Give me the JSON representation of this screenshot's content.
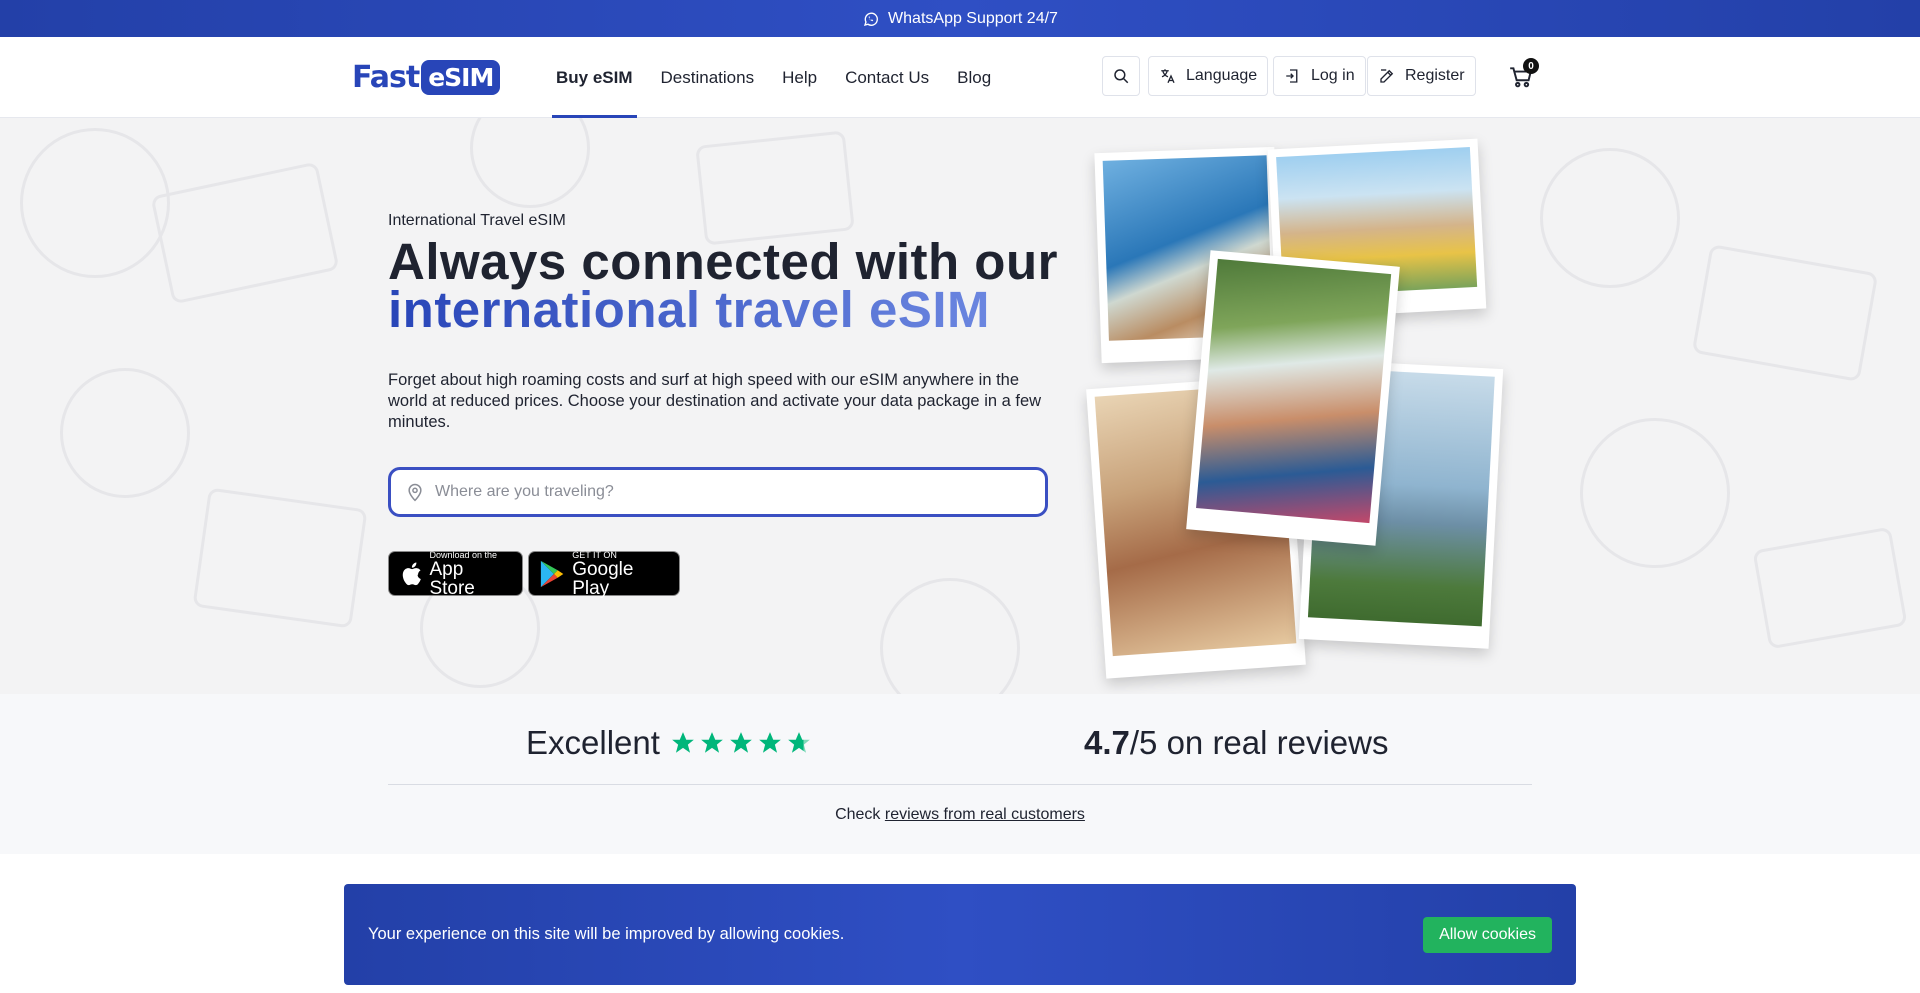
{
  "topbar": {
    "text": "WhatsApp Support 24/7",
    "icon": "whatsapp-icon"
  },
  "logo": {
    "part1": "Fast",
    "part2": "eSIM"
  },
  "nav": {
    "items": [
      {
        "label": "Buy eSIM",
        "active": true
      },
      {
        "label": "Destinations"
      },
      {
        "label": "Help"
      },
      {
        "label": "Contact Us"
      },
      {
        "label": "Blog"
      }
    ]
  },
  "header_actions": {
    "language": "Language",
    "login": "Log in",
    "register": "Register",
    "cart_count": "0"
  },
  "hero": {
    "eyebrow": "International Travel eSIM",
    "title_line1": "Always connected with our",
    "title_line2": "international travel eSIM",
    "description": "Forget about high roaming costs and surf at high speed with our eSIM anywhere in the world at reduced prices. Choose your destination and activate your data package in a few minutes.",
    "search_placeholder": "Where are you traveling?",
    "app_store_small": "Download on the",
    "app_store_big": "App Store",
    "google_play_small": "GET IT ON",
    "google_play_big": "Google Play"
  },
  "reviews": {
    "label": "Excellent",
    "rating": "4.7",
    "scale": "/5 on real reviews",
    "check_prefix": "Check ",
    "check_link": "reviews from real customers",
    "star_color": "#00b67a"
  },
  "cookie": {
    "message": "Your experience on this site will be improved by allowing cookies.",
    "button": "Allow cookies"
  },
  "colors": {
    "brand": "#2845b8",
    "accent_green": "#22b35e"
  }
}
